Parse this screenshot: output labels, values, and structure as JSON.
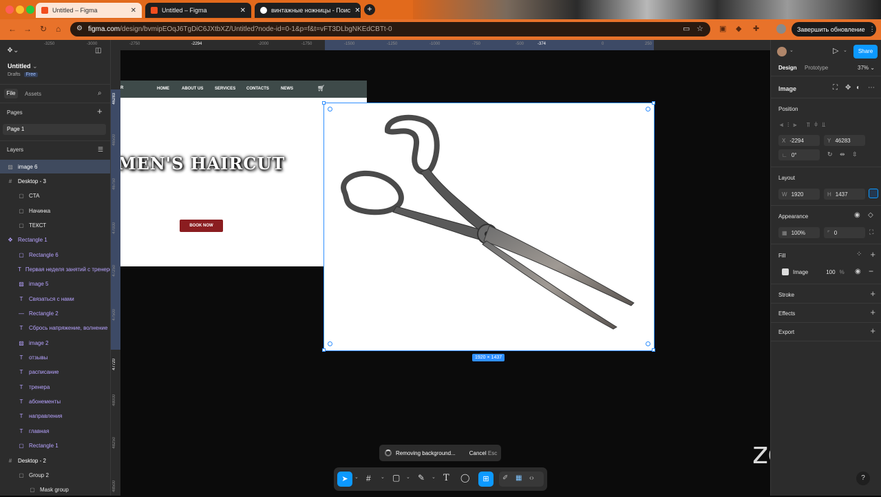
{
  "browser": {
    "tabs": [
      {
        "title": "Untitled – Figma",
        "active": true
      },
      {
        "title": "Untitled – Figma",
        "active": false
      },
      {
        "title": "винтажные ножницы - Поис",
        "active": false
      }
    ],
    "url_main": "figma.com",
    "url_rest": "/design/bvmipEOqJ6TgDiC6JXtbXZ/Untitled?node-id=0-1&p=f&t=vFT3DLbgNKEdCBTt-0",
    "update_button": "Завершить обновление"
  },
  "file": {
    "name": "Untitled",
    "location": "Drafts",
    "plan": "Free"
  },
  "left_tabs": {
    "file": "File",
    "assets": "Assets"
  },
  "pages": {
    "heading": "Pages",
    "items": [
      "Page 1"
    ]
  },
  "layers": {
    "heading": "Layers",
    "items": [
      {
        "name": "image 6",
        "icon": "image-icon",
        "indent": 0,
        "selected": true
      },
      {
        "name": "Desktop - 3",
        "icon": "frame-icon",
        "indent": 0
      },
      {
        "name": "CTA",
        "icon": "rect-icon",
        "indent": 1
      },
      {
        "name": "Начинка",
        "icon": "rect-icon",
        "indent": 1
      },
      {
        "name": "ТЕКСТ",
        "icon": "rect-icon",
        "indent": 1
      },
      {
        "name": "Rectangle 1",
        "icon": "component-icon",
        "indent": 0,
        "purple": true
      },
      {
        "name": "Rectangle 6",
        "icon": "rect-icon",
        "indent": 1,
        "purple": true
      },
      {
        "name": "Первая неделя занятий с тренером",
        "icon": "text-icon",
        "indent": 1,
        "purple": true
      },
      {
        "name": "image 5",
        "icon": "image-icon",
        "indent": 1,
        "purple": true
      },
      {
        "name": "Связаться с нами",
        "icon": "text-icon",
        "indent": 1,
        "purple": true
      },
      {
        "name": "Rectangle 2",
        "icon": "line-icon",
        "indent": 1,
        "purple": true
      },
      {
        "name": "Сбрось напряжение, волнение",
        "icon": "text-icon",
        "indent": 1,
        "purple": true
      },
      {
        "name": "image 2",
        "icon": "image-icon",
        "indent": 1,
        "purple": true
      },
      {
        "name": "отзывы",
        "icon": "text-icon",
        "indent": 1,
        "purple": true
      },
      {
        "name": "расписание",
        "icon": "text-icon",
        "indent": 1,
        "purple": true
      },
      {
        "name": "тренера",
        "icon": "text-icon",
        "indent": 1,
        "purple": true
      },
      {
        "name": "абонементы",
        "icon": "text-icon",
        "indent": 1,
        "purple": true
      },
      {
        "name": "направления",
        "icon": "text-icon",
        "indent": 1,
        "purple": true
      },
      {
        "name": "главная",
        "icon": "text-icon",
        "indent": 1,
        "purple": true
      },
      {
        "name": "Rectangle 1",
        "icon": "rect-icon",
        "indent": 1,
        "purple": true
      },
      {
        "name": "Desktop - 2",
        "icon": "frame-icon",
        "indent": 0
      },
      {
        "name": "Group 2",
        "icon": "rect-icon",
        "indent": 1
      },
      {
        "name": "Mask group",
        "icon": "rect-icon",
        "indent": 2
      }
    ]
  },
  "ruler": {
    "top": [
      "-3250",
      "-3000",
      "-2750",
      "-2294",
      "-2000",
      "-1750",
      "-1500",
      "-1250",
      "-1000",
      "-750",
      "-500",
      "-374",
      "0",
      "250"
    ],
    "left": [
      "46283",
      "46500",
      "46750",
      "47000",
      "47250",
      "47500",
      "47720",
      "48000",
      "48250",
      "48500"
    ]
  },
  "site": {
    "nav": [
      "HOME",
      "ABOUT US",
      "SERVICES",
      "CONTACTS",
      "NEWS"
    ],
    "nav_prefix": "R",
    "headline": "MEN'S HAIRCUT",
    "cta": "BOOK NOW"
  },
  "selection": {
    "size_label": "1920 × 1437"
  },
  "toast": {
    "message": "Removing background...",
    "cancel": "Cancel",
    "shortcut": "Esc"
  },
  "right": {
    "tabs": {
      "design": "Design",
      "prototype": "Prototype"
    },
    "zoom": "37%",
    "share": "Share",
    "title": "Image",
    "position": {
      "heading": "Position",
      "x_label": "X",
      "x": "-2294",
      "y_label": "Y",
      "y": "46283",
      "rotation": "0°"
    },
    "layout": {
      "heading": "Layout",
      "w_label": "W",
      "w": "1920",
      "h_label": "H",
      "h": "1437"
    },
    "appearance": {
      "heading": "Appearance",
      "opacity": "100%",
      "radius": "0"
    },
    "fill": {
      "heading": "Fill",
      "type": "Image",
      "opacity": "100",
      "unit": "%"
    },
    "stroke": "Stroke",
    "effects": "Effects",
    "export": "Export"
  },
  "overlay": {
    "zoom_logo": "zoom",
    "help": "?"
  },
  "colors": {
    "accent": "#0d99ff",
    "selection": "#2f8fff",
    "site_nav_bg": "#3e4a49",
    "cta_bg": "#8b1d20",
    "chrome_orange": "#e8722a"
  }
}
